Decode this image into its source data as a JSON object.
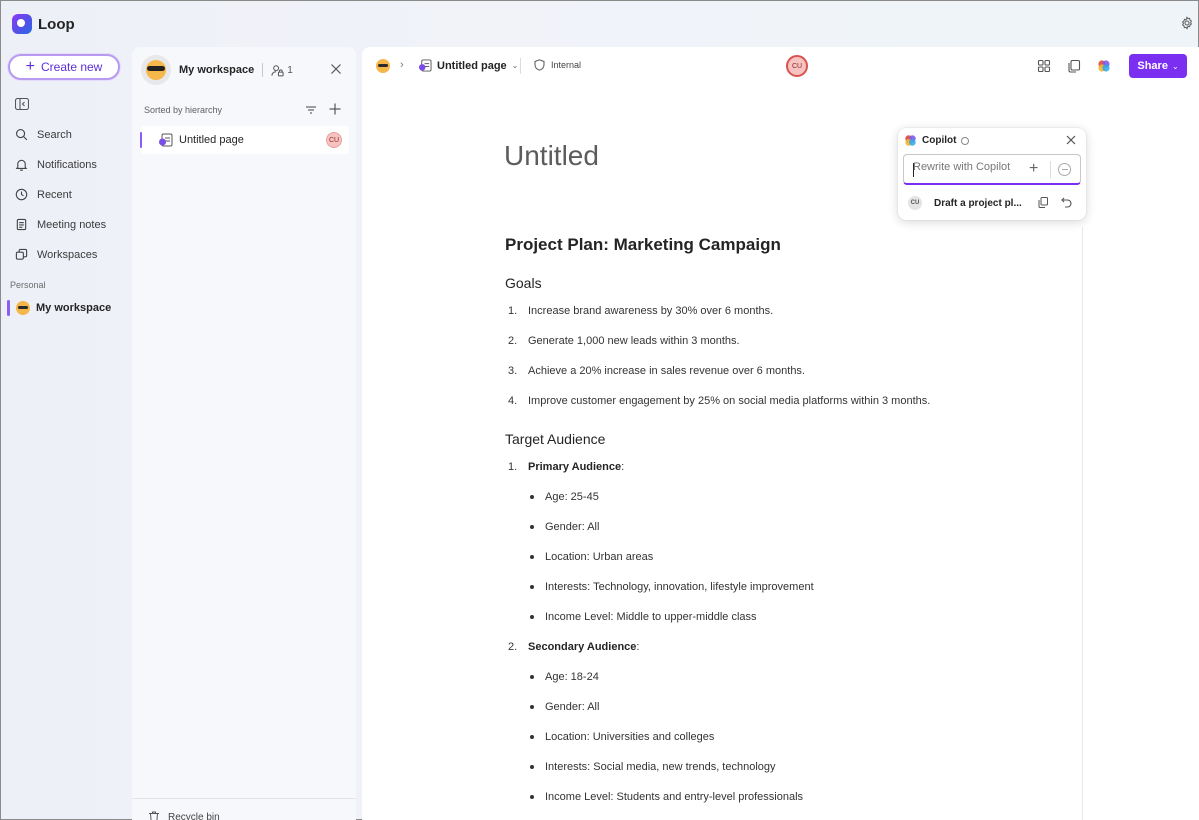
{
  "app": {
    "name": "Loop"
  },
  "nav": {
    "create_label": "Create new",
    "items": [
      {
        "label": "Search",
        "icon": "search-icon"
      },
      {
        "label": "Notifications",
        "icon": "bell-icon"
      },
      {
        "label": "Recent",
        "icon": "clock-icon"
      },
      {
        "label": "Meeting notes",
        "icon": "notes-icon"
      },
      {
        "label": "Workspaces",
        "icon": "workspaces-icon"
      }
    ],
    "section_label": "Personal",
    "workspace_label": "My workspace"
  },
  "workspace": {
    "title": "My workspace",
    "member_count": "1",
    "sorted_label": "Sorted by hierarchy",
    "pages": [
      {
        "label": "Untitled page",
        "avatar": "CU"
      }
    ],
    "recycle_label": "Recycle bin"
  },
  "toolbar": {
    "page_label": "Untitled page",
    "sensitivity_label": "Internal",
    "presence_initials": "CU",
    "share_label": "Share"
  },
  "copilot": {
    "title": "Copilot",
    "placeholder": "Rewrite with Copilot",
    "history_initials": "CU",
    "history_label": "Draft a project pl..."
  },
  "document": {
    "title": "Untitled",
    "heading": "Project Plan: Marketing Campaign",
    "goals_heading": "Goals",
    "goals": [
      "Increase brand awareness by 30% over 6 months.",
      "Generate 1,000 new leads within 3 months.",
      "Achieve a 20% increase in sales revenue over 6 months.",
      "Improve customer engagement by 25% on social media platforms within 3 months."
    ],
    "audience_heading": "Target Audience",
    "primary": {
      "label": "Primary Audience",
      "items": [
        "Age: 25-45",
        "Gender: All",
        "Location: Urban areas",
        "Interests: Technology, innovation, lifestyle improvement",
        "Income Level: Middle to upper-middle class"
      ]
    },
    "secondary": {
      "label": "Secondary Audience",
      "items": [
        "Age: 18-24",
        "Gender: All",
        "Location: Universities and colleges",
        "Interests: Social media, new trends, technology",
        "Income Level: Students and entry-level professionals"
      ]
    }
  },
  "colors": {
    "accent": "#7b2ff0",
    "selection": "#8b5cf6",
    "presence_ring": "#d9534f"
  }
}
